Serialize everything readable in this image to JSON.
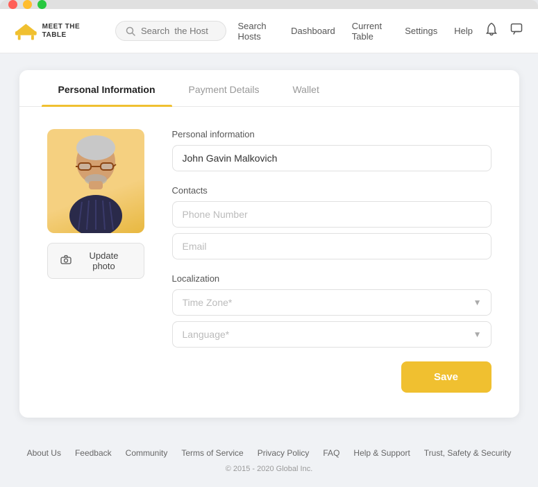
{
  "window": {
    "traffic": [
      "red",
      "yellow",
      "green"
    ]
  },
  "navbar": {
    "logo_text": "MEET THE TABLE",
    "search_placeholder": "Search  the Host",
    "nav_links": [
      {
        "label": "Search Hosts"
      },
      {
        "label": "Dashboard"
      },
      {
        "label": "Current Table"
      },
      {
        "label": "Settings"
      },
      {
        "label": "Help"
      }
    ]
  },
  "card": {
    "tabs": [
      {
        "label": "Personal Information",
        "active": true
      },
      {
        "label": "Payment Details",
        "active": false
      },
      {
        "label": "Wallet",
        "active": false
      }
    ],
    "photo_section": {
      "update_label": "Update photo"
    },
    "form": {
      "personal_info_label": "Personal information",
      "name_value": "John Gavin Malkovich",
      "contacts_label": "Contacts",
      "phone_placeholder": "Phone Number",
      "email_placeholder": "Email",
      "localization_label": "Localization",
      "timezone_placeholder": "Time Zone*",
      "language_placeholder": "Language*",
      "save_label": "Save"
    }
  },
  "footer": {
    "links": [
      {
        "label": "About Us"
      },
      {
        "label": "Feedback"
      },
      {
        "label": "Community"
      },
      {
        "label": "Terms of Service"
      },
      {
        "label": "Privacy Policy"
      },
      {
        "label": "FAQ"
      },
      {
        "label": "Help & Support"
      },
      {
        "label": "Trust, Safety & Security"
      }
    ],
    "copyright": "© 2015 - 2020 Global Inc."
  }
}
